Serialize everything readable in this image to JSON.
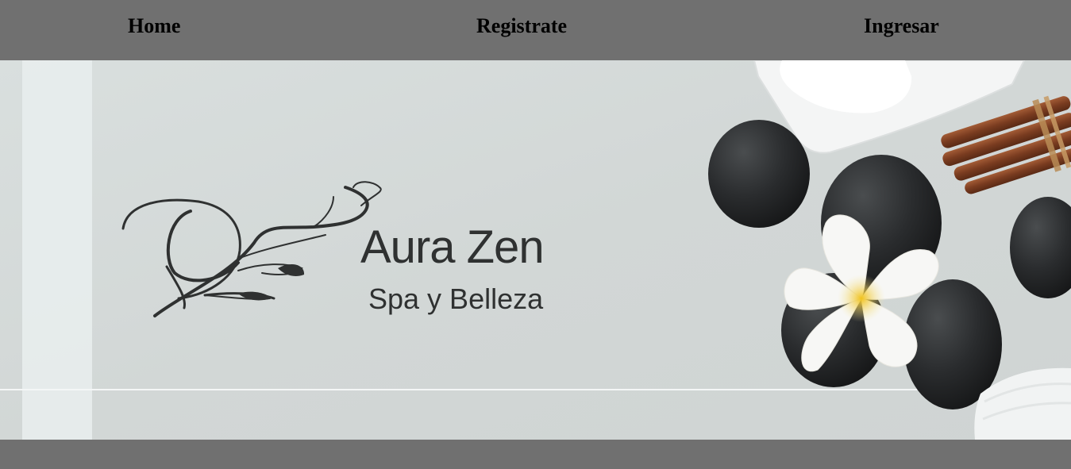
{
  "nav": {
    "home": "Home",
    "registrate": "Registrate",
    "ingresar": "Ingresar"
  },
  "banner": {
    "brand": "Aura Zen",
    "tagline": "Spa y Belleza"
  },
  "colors": {
    "nav_bg": "#707070",
    "banner_bg": "#d4d9d8",
    "logo_ink": "#2f3131"
  },
  "icons": [
    "logo-flourish-icon",
    "hot-stones-icon",
    "plumeria-flower-icon",
    "cinnamon-sticks-icon",
    "cream-dish-icon",
    "towel-icon"
  ]
}
